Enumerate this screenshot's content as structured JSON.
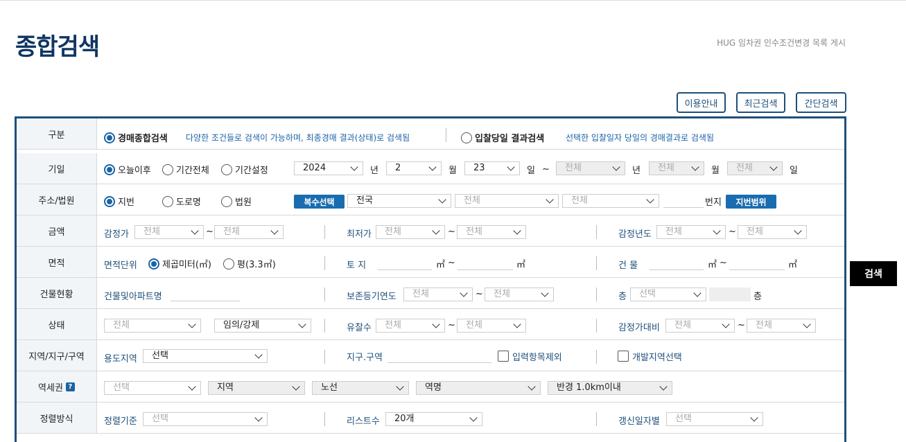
{
  "page": {
    "title": "종합검색",
    "top_link": "HUG 임차권 인수조건변경 목록 게시"
  },
  "top_buttons": {
    "guide": "이용안내",
    "recent": "최근검색",
    "simple": "간단검색"
  },
  "search_button": "검색",
  "rows": {
    "gubun": {
      "label": "구분",
      "opt1": "경매종합검색",
      "opt1_desc": "다양한 조건들로 검색이 가능하며, 최종경매 결과(상태)로 검색됨",
      "opt2": "입찰당일 결과검색",
      "opt2_desc": "선택한 입찰일자 당일의 경매결과로 검색됨"
    },
    "period": {
      "label": "기일",
      "opt1": "오늘이후",
      "opt2": "기간전체",
      "opt3": "기간설정",
      "year": "2024",
      "year_unit": "년",
      "month": "2",
      "month_unit": "월",
      "day": "23",
      "day_unit": "일",
      "tilde": "~",
      "end_year": "전체",
      "end_year_unit": "년",
      "end_month": "전체",
      "end_month_unit": "월",
      "end_day": "전체",
      "end_day_unit": "일"
    },
    "address": {
      "label": "주소/법원",
      "opt1": "지번",
      "opt2": "도로명",
      "opt3": "법원",
      "multi_btn": "복수선택",
      "sido": "전국",
      "sigungu": "전체",
      "dong": "전체",
      "bunji_unit": "번지",
      "range_btn": "지번범위"
    },
    "price": {
      "label": "금액",
      "appraisal": "감정가",
      "appraisal_from": "전체",
      "appraisal_to": "전체",
      "minimum": "최저가",
      "minimum_from": "전체",
      "minimum_to": "전체",
      "appraisal_year": "감정년도",
      "year_from": "전체",
      "year_to": "전체",
      "tilde": "~"
    },
    "area": {
      "label": "면적",
      "unit_label": "면적단위",
      "unit_opt1": "제곱미터(㎡)",
      "unit_opt2": "평(3.3㎡)",
      "land": "토 지",
      "building": "건 물",
      "sqm": "㎡",
      "tilde": "~"
    },
    "building": {
      "label": "건물현황",
      "name_label": "건물및아파트명",
      "reg_year": "보존등기연도",
      "reg_from": "전체",
      "reg_to": "전체",
      "floor": "층",
      "floor_sel": "선택",
      "floor_unit": "층",
      "tilde": "~"
    },
    "status": {
      "label": "상태",
      "status_sel": "전체",
      "type_sel": "임의/강제",
      "fail_count": "유찰수",
      "fail_from": "전체",
      "fail_to": "전체",
      "ratio": "감정가대비",
      "ratio_from": "전체",
      "ratio_to": "전체",
      "tilde": "~"
    },
    "zone": {
      "label": "지역/지구/구역",
      "use_area": "용도지역",
      "use_sel": "선택",
      "district": "지구.구역",
      "exclude": "입력항목제외",
      "dev_area": "개발지역선택"
    },
    "station": {
      "label": "역세권",
      "help": "?",
      "sel1": "선택",
      "sel2": "지역",
      "sel3": "노선",
      "sel4": "역명",
      "sel5": "반경 1.0km이내"
    },
    "sort": {
      "label": "정렬방식",
      "basis": "정렬기준",
      "basis_sel": "선택",
      "list_count": "리스트수",
      "list_sel": "20개",
      "renew": "갱신일자별",
      "renew_sel": "선택"
    }
  }
}
